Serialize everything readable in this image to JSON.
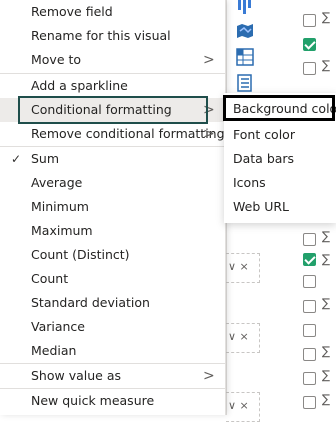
{
  "menu": {
    "items": [
      {
        "label": "Remove field",
        "chevron": false
      },
      {
        "label": "Rename for this visual",
        "chevron": false
      },
      {
        "label": "Move to",
        "chevron": true
      },
      {
        "label": "Add a sparkline",
        "chevron": false
      },
      {
        "label": "Conditional formatting",
        "chevron": true
      },
      {
        "label": "Remove conditional formatting",
        "chevron": true
      },
      {
        "label": "Sum",
        "checked": true
      },
      {
        "label": "Average"
      },
      {
        "label": "Minimum"
      },
      {
        "label": "Maximum"
      },
      {
        "label": "Count (Distinct)"
      },
      {
        "label": "Count"
      },
      {
        "label": "Standard deviation"
      },
      {
        "label": "Variance"
      },
      {
        "label": "Median"
      },
      {
        "label": "Show value as",
        "chevron": true
      },
      {
        "label": "New quick measure"
      }
    ],
    "chevron_glyph": ">",
    "check_glyph": "✓"
  },
  "submenu": {
    "items": [
      "Background color",
      "Font color",
      "Data bars",
      "Icons",
      "Web URL"
    ]
  },
  "background": {
    "sigma": "∑",
    "field_close": "∨ ×",
    "accent_green": "#22a06b"
  },
  "colors": {
    "highlight_outline": "#1f4e4b",
    "selected_outline": "#000000"
  }
}
